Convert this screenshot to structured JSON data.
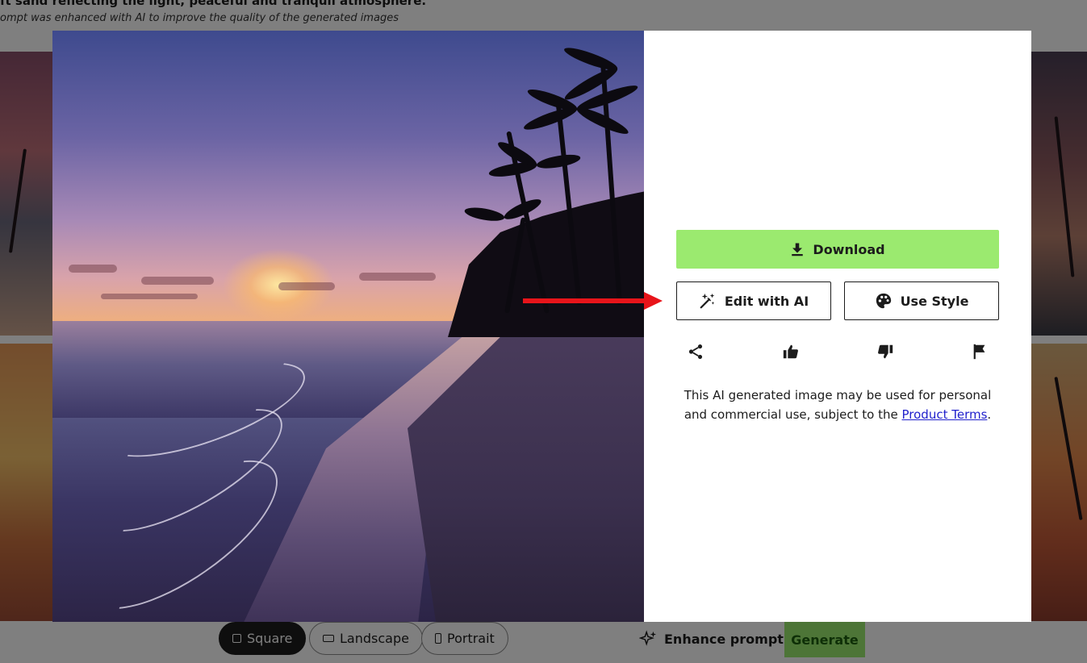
{
  "background_page": {
    "prompt_text": "ft sand reflecting the light, peaceful and tranquil atmosphere.",
    "enhanced_note": "ompt was enhanced with AI to improve the quality of the generated images",
    "shape_options": [
      {
        "label": "Square",
        "icon": "square-icon",
        "selected": true
      },
      {
        "label": "Landscape",
        "icon": "landscape-icon",
        "selected": false
      },
      {
        "label": "Portrait",
        "icon": "portrait-icon",
        "selected": false
      }
    ],
    "enhance_prompt_label": "Enhance prompt",
    "generate_label": "Generate"
  },
  "modal": {
    "image_alt_subject": "beach-sunset-with-palm-trees",
    "download_label": "Download",
    "edit_with_ai_label": "Edit with AI",
    "use_style_label": "Use Style",
    "actions": [
      {
        "name": "share-icon"
      },
      {
        "name": "thumbs-up-icon"
      },
      {
        "name": "thumbs-down-icon"
      },
      {
        "name": "flag-icon"
      }
    ],
    "terms_text": "This AI generated image may be used for personal and commercial use, subject to the ",
    "terms_link": "Product Terms",
    "terms_end": "."
  },
  "colors": {
    "accent_green": "#9bea6f",
    "annotation_red": "#e8141a",
    "link_blue": "#2222cc"
  }
}
